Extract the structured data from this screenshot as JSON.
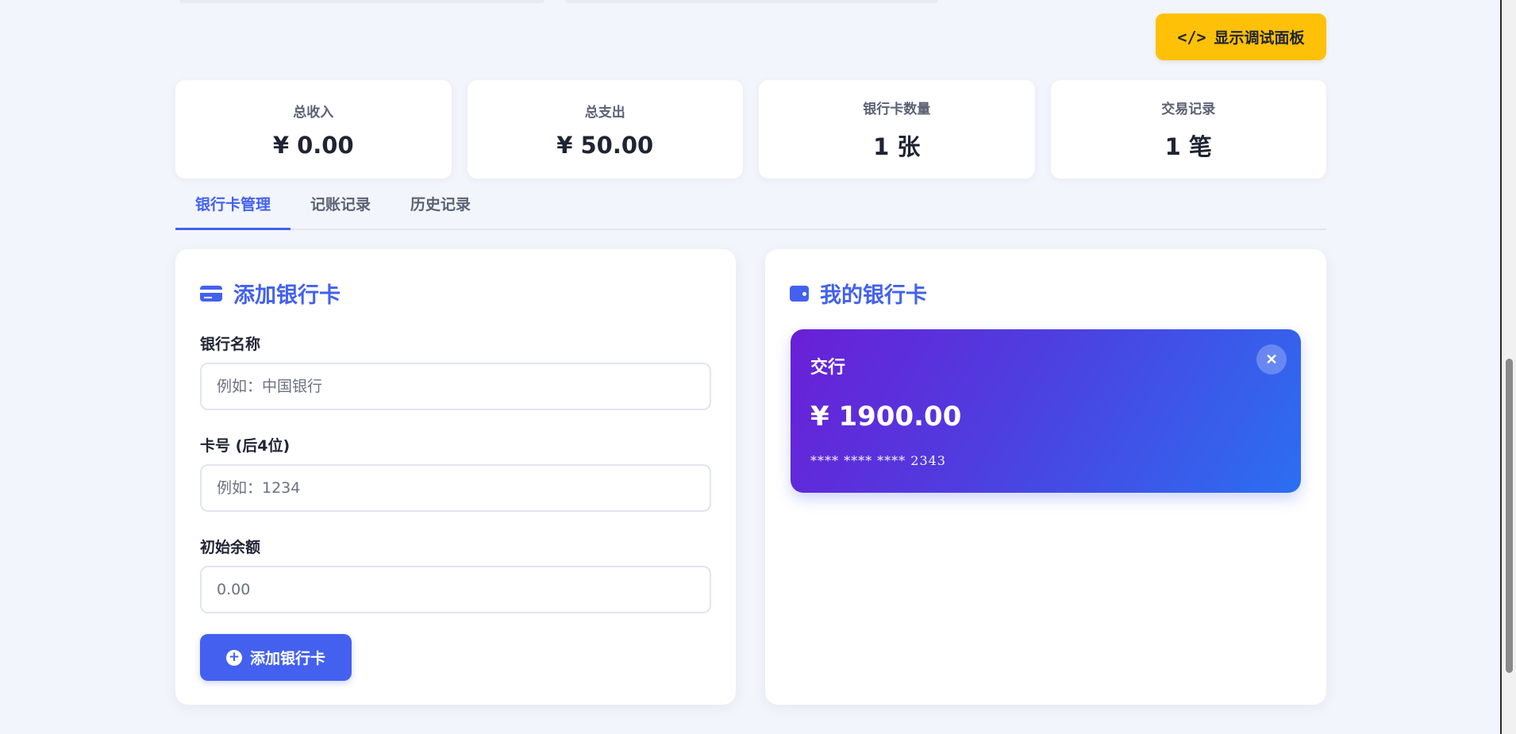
{
  "debug_button": {
    "label": "显示调试面板",
    "icon": "code-icon"
  },
  "stats": [
    {
      "label": "总收入",
      "value": "¥ 0.00"
    },
    {
      "label": "总支出",
      "value": "¥ 50.00"
    },
    {
      "label": "银行卡数量",
      "value": "1 张"
    },
    {
      "label": "交易记录",
      "value": "1 笔"
    }
  ],
  "tabs": [
    {
      "label": "银行卡管理",
      "active": true
    },
    {
      "label": "记账记录",
      "active": false
    },
    {
      "label": "历史记录",
      "active": false
    }
  ],
  "add_card": {
    "title": "添加银行卡",
    "icon": "credit-card-icon",
    "fields": [
      {
        "label": "银行名称",
        "placeholder": "例如：中国银行",
        "value": ""
      },
      {
        "label": "卡号 (后4位)",
        "placeholder": "例如：1234",
        "value": ""
      },
      {
        "label": "初始余额",
        "placeholder": "0.00",
        "value": ""
      }
    ],
    "submit_label": "添加银行卡",
    "submit_icon": "plus-circle-icon"
  },
  "my_cards": {
    "title": "我的银行卡",
    "icon": "wallet-icon",
    "cards": [
      {
        "bank": "交行",
        "balance": "¥ 1900.00",
        "number": "**** **** **** 2343",
        "close_icon": "close-icon"
      }
    ]
  },
  "colors": {
    "primary": "#4361ee",
    "warning": "#ffc107",
    "card_gradient_start": "#6a1fd6",
    "card_gradient_end": "#2b6ff2"
  }
}
